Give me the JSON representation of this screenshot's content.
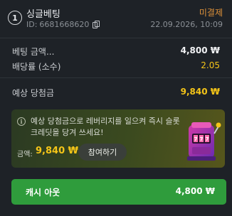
{
  "header": {
    "number": "1",
    "bet_type": "싱글베팅",
    "id_label": "ID:",
    "id_value": "6681668620",
    "status": "미결제",
    "datetime": "22.09.2026, 10:09",
    "status_color": "#e0923a"
  },
  "details": {
    "stake_label": "베팅 금액...",
    "stake_value": "4,800 ₩",
    "odds_label": "배당률 (소수)",
    "odds_value": "2.05"
  },
  "payout": {
    "label": "예상 당첨금",
    "value": "9,840 ₩"
  },
  "promo": {
    "text": "예상 당첨금으로 레버리지를 일으켜 즉시 슬롯 크레딧을 당겨 쓰세요!",
    "amount_label": "금액:",
    "amount_value": "9,840 ₩",
    "optin_label": "참여하기",
    "image_icon": "slot-machine-icon"
  },
  "cashout": {
    "label": "캐시 아웃",
    "amount": "4,800 ₩",
    "color": "#2f9c3c"
  },
  "colors": {
    "background": "#1e2227",
    "highlight_yellow": "#f5c518"
  }
}
